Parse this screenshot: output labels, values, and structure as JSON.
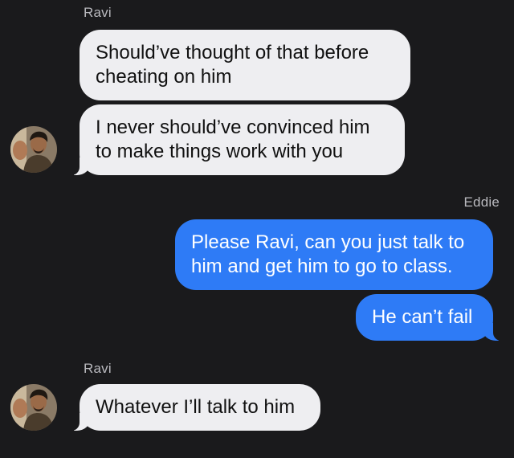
{
  "conversation": {
    "groups": [
      {
        "sender": "Ravi",
        "messages": [
          "Should’ve thought of that before cheating on him",
          "I never should’ve convinced him to make things work with you"
        ]
      },
      {
        "sender": "Eddie",
        "messages": [
          "Please Ravi, can you just talk to him and get him to go to class.",
          "He can’t fail"
        ]
      },
      {
        "sender": "Ravi",
        "messages": [
          "Whatever I’ll talk to him"
        ]
      }
    ]
  },
  "colors": {
    "background": "#1a1a1c",
    "incoming_bubble": "#eeeef1",
    "outgoing_bubble": "#2e7bf6",
    "sender_label": "#b9b9be"
  },
  "icons": {
    "avatar": "contact-photo-avatar"
  }
}
